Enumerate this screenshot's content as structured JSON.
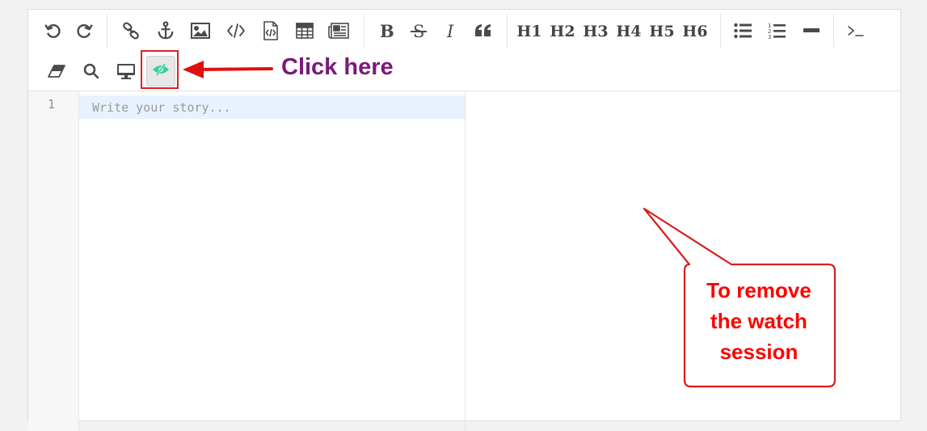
{
  "toolbar": {
    "row1": [
      "undo-icon",
      "redo-icon",
      "link-icon",
      "anchor-icon",
      "image-icon",
      "code-inline-icon",
      "code-block-icon",
      "table-icon",
      "datetime-icon",
      "bold-icon",
      "strikethrough-icon",
      "italic-icon",
      "quote-icon"
    ],
    "headings": [
      "H1",
      "H2",
      "H3",
      "H4",
      "H5",
      "H6"
    ],
    "row1_tail": [
      "unordered-list-icon",
      "ordered-list-icon",
      "hr-icon",
      "terminal-icon"
    ],
    "row2": [
      "eraser-icon",
      "search-icon",
      "preview-monitor-icon",
      "watch-toggle-icon"
    ]
  },
  "editor": {
    "line_number": "1",
    "placeholder": "Write your story..."
  },
  "annotation": {
    "click_label": "Click here",
    "callout_lines": [
      "To remove",
      "the watch",
      "session"
    ],
    "colors": {
      "box": "#e02020",
      "arrow": "#e01010",
      "click_text": "#7a1a7a",
      "callout_text": "#ff0000"
    }
  }
}
